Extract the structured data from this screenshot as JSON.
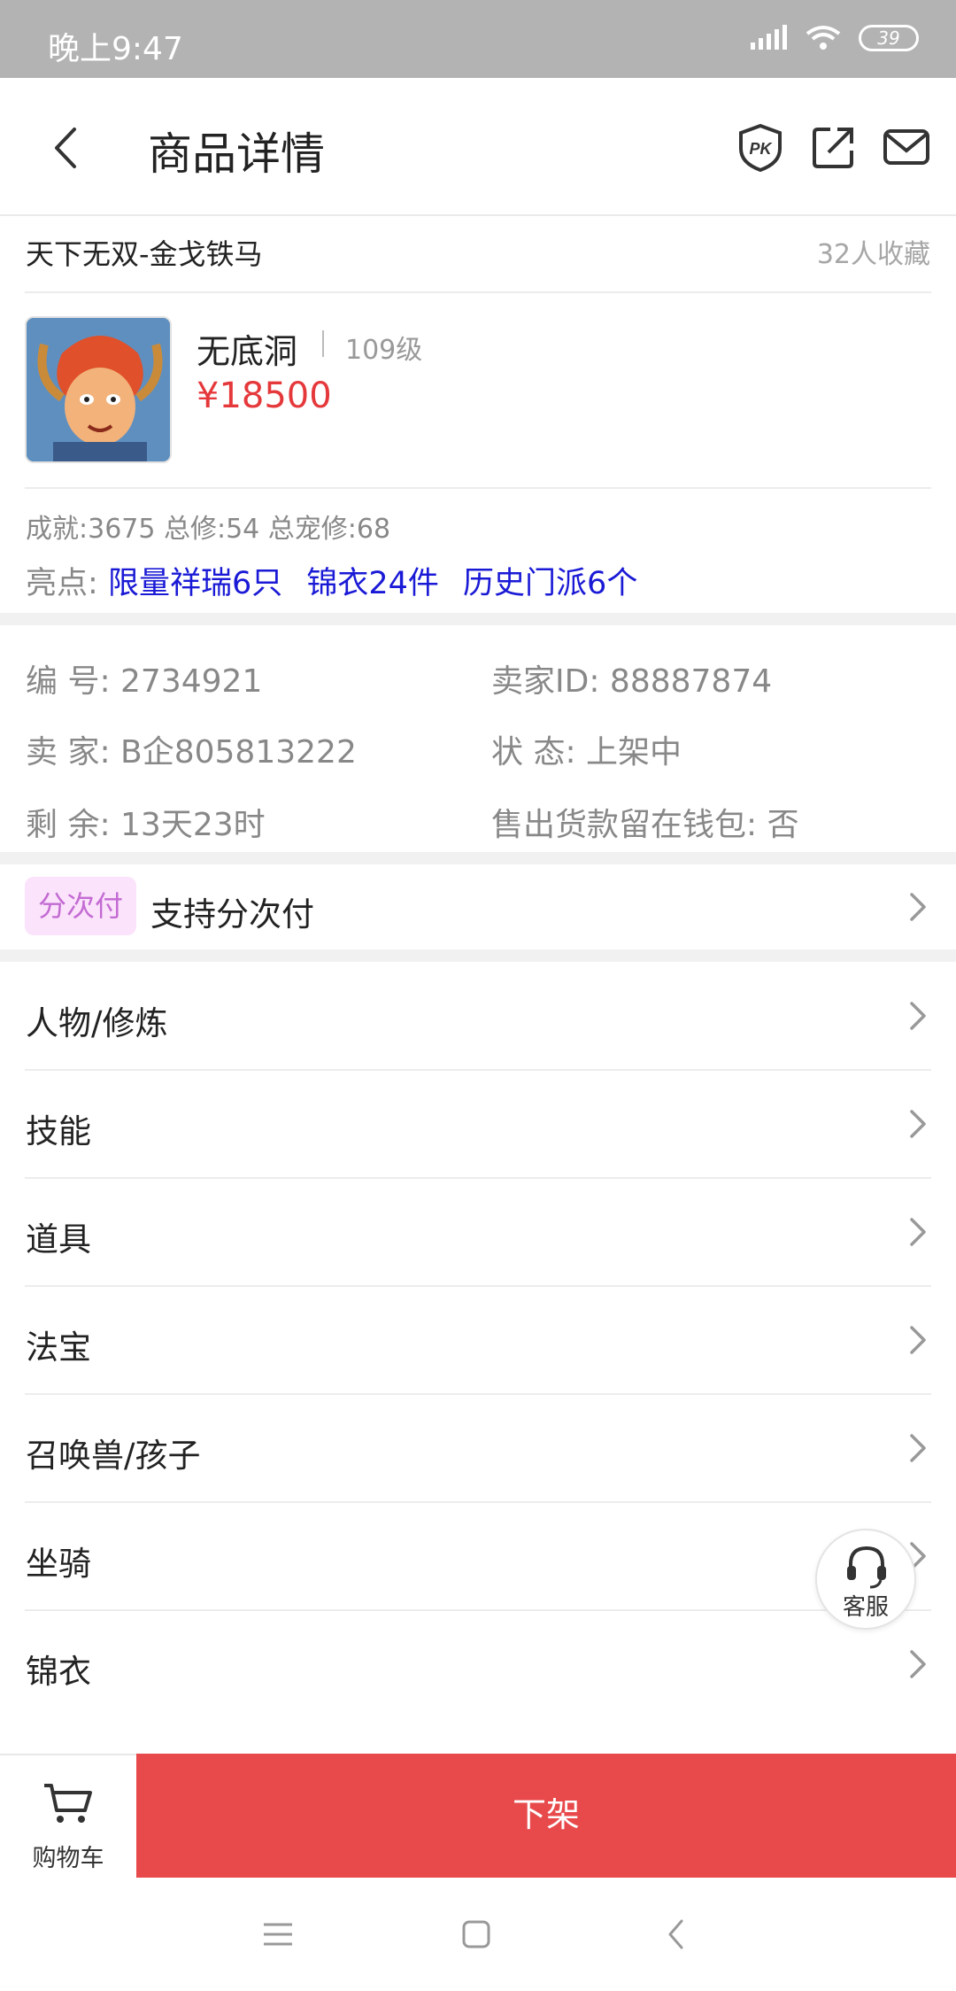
{
  "status_bar": {
    "time": "晚上9:47",
    "battery": "39"
  },
  "header": {
    "title": "商品详情"
  },
  "product": {
    "title": "天下无双-金戈铁马",
    "favorites": "32人收藏",
    "server": "无底洞",
    "level": "109级",
    "price": "¥18500",
    "stats": "成就:3675 总修:54 总宠修:68",
    "highlights_label": "亮点:",
    "highlights": [
      "限量祥瑞6只",
      "锦衣24件",
      "历史门派6个"
    ]
  },
  "info": {
    "number": "编  号: 2734921",
    "seller_id": "卖家ID: 88887874",
    "seller": "卖  家: B企805813222",
    "status": "状  态: 上架中",
    "remaining": "剩  余: 13天23时",
    "wallet": "售出货款留在钱包: 否"
  },
  "installment": {
    "badge": "分次付",
    "text": "支持分次付"
  },
  "menu": [
    {
      "label": "人物/修炼"
    },
    {
      "label": "技能"
    },
    {
      "label": "道具"
    },
    {
      "label": "法宝"
    },
    {
      "label": "召唤兽/孩子"
    },
    {
      "label": "坐骑"
    },
    {
      "label": "锦衣"
    }
  ],
  "service": {
    "label": "客服"
  },
  "bottom": {
    "cart_label": "购物车",
    "action_label": "下架"
  },
  "colors": {
    "price": "#e5383b",
    "highlight": "#1a1ad6",
    "action": "#e84a4c",
    "badge_bg": "#fbe3fb",
    "badge_text": "#c36bd3"
  },
  "icons": [
    "back-arrow-icon",
    "pk-shield-icon",
    "share-icon",
    "mail-icon",
    "cart-icon",
    "headset-icon",
    "chevron-right-icon"
  ]
}
